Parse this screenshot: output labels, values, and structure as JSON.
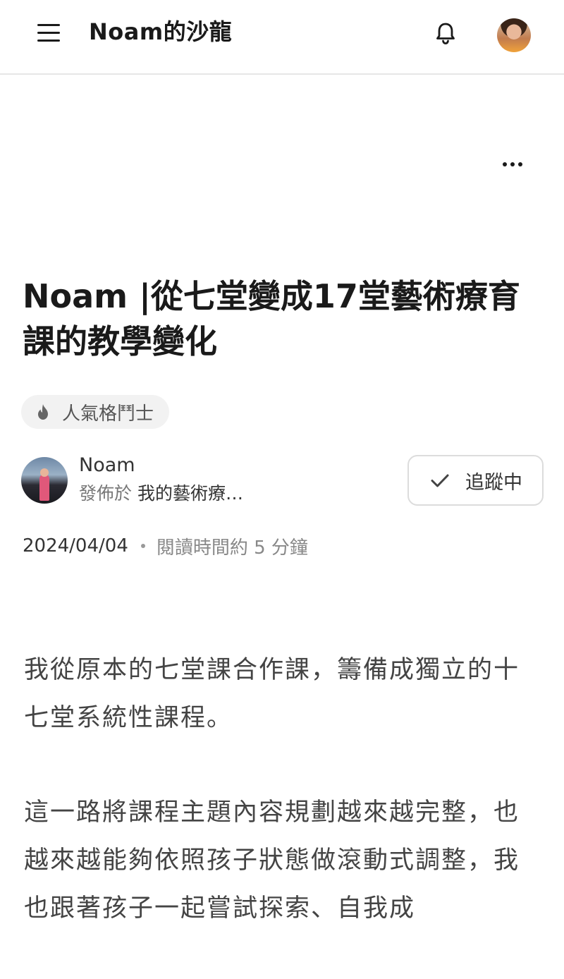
{
  "header": {
    "site_title": "Noam的沙龍"
  },
  "icons": {
    "menu": "hamburger-menu-icon",
    "bell": "bell-icon",
    "more": "more-horizontal-icon",
    "tag": "flame-icon",
    "follow": "check-icon"
  },
  "article": {
    "title": "Noam |從七堂變成17堂藝術療育課的教學變化",
    "tag": "人氣格鬥士",
    "author": {
      "name": "Noam",
      "publish_prefix": "發佈於",
      "collection": "我的藝術療…"
    },
    "follow_label": "追蹤中",
    "date": "2024/04/04",
    "read_time": "閱讀時間約 5 分鐘",
    "paragraphs": [
      "我從原本的七堂課合作課，籌備成獨立的十七堂系統性課程。",
      "這一路將課程主題內容規劃越來越完整，也越來越能夠依照孩子狀態做滾動式調整，我也跟著孩子一起嘗試探索、自我成"
    ]
  },
  "colors": {
    "text_primary": "#1a1a1a",
    "text_secondary": "#666666",
    "chip_background": "#f2f2f2",
    "divider": "#e6e6e6"
  }
}
